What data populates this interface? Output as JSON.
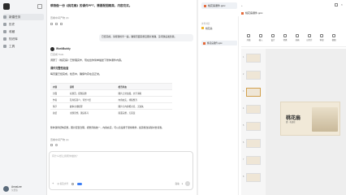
{
  "app": {
    "title": "帮我做一份《桃花扇》的课件PPT，需要配图精美，内容充实。"
  },
  "sidebar": {
    "items": [
      {
        "label": "新建任务"
      },
      {
        "label": "历史"
      },
      {
        "label": "收藏"
      },
      {
        "label": "知识库"
      },
      {
        "label": "工具"
      }
    ],
    "user": {
      "name": "AnnaLee",
      "sub": "免费版"
    }
  },
  "chat": {
    "header_title": "帮我做一份《桃花扇》的课件PPT，需要配图精美，内容充实。",
    "meta": "查看中间产物 (3)",
    "user_bubble": "已经完成，请帮我检查一遍，确保页面完整且图片准确，没问题后发给我。",
    "agent_name": "WorkBuddy",
    "agent_sub": "已完成 Todo",
    "intro": "调研了《桃花扇》已整理完毕，现在给你简单描述下整体课件内容。",
    "section1": "课件完整性检查",
    "section1_text": "每页面已经完成，检查中，确保均存在且正常。",
    "table": {
      "headers": [
        "内容",
        "说明",
        "检查状态"
      ],
      "rows": [
        [
          "封面",
          "标题页，配图完整",
          "图片正常加载，文字清晰"
        ],
        [
          "作者",
          "孔尚任简介，背景介绍",
          "内容充实，排版整齐"
        ],
        [
          "情节",
          "故事主线梳理",
          "图片与内容相对应，无缺失"
        ],
        [
          "总结",
          "主题思想，课后练习",
          "版面完整，无错误"
        ]
      ]
    },
    "summary": "整体课件结构完整，图片配置合理，视觉风格统一，内容充实，可以直接用于课堂教学。如需修改请随时告诉我。",
    "meta2": "查看中间产物 (4)",
    "input_placeholder": "有什么想让我帮你做的？",
    "input_hint": "@ 提及文件",
    "mode_label": "自动",
    "send_label": "发送"
  },
  "preview": {
    "tabs": [
      {
        "label": "桃花扇课件.pptx"
      },
      {
        "label": "+"
      }
    ],
    "file_tab": "桃花扇课件.pptx",
    "nav_label": "文件浏览",
    "nav_items": [
      {
        "label": "桃花扇"
      },
      {
        "label": "桃花扇课件.pptx"
      }
    ],
    "toolbar": [
      "开始",
      "插入",
      "设计",
      "切换",
      "动画",
      "幻灯片",
      "审阅",
      "视图"
    ],
    "slide_count": 8,
    "main_slide_title": "桃花扇",
    "main_slide_sub": "清 · 孔尚任"
  }
}
